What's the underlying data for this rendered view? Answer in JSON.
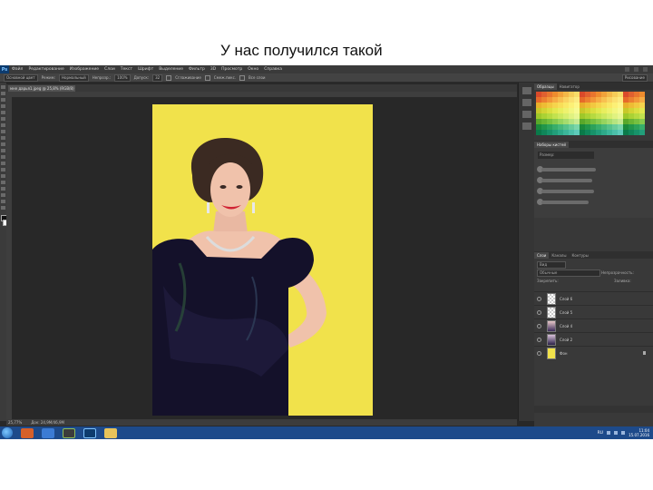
{
  "slide": {
    "caption": "У нас получился такой"
  },
  "app": {
    "logo": "Ps",
    "menu": [
      "Файл",
      "Редактирование",
      "Изображение",
      "Слои",
      "Текст",
      "Шрифт",
      "Выделение",
      "Фильтр",
      "3D",
      "Просмотр",
      "Окно",
      "Справка"
    ],
    "options": {
      "preset": "Основной цвет",
      "mode_label": "Режим:",
      "mode_value": "Нормальный",
      "opacity_label": "Непрозр.:",
      "opacity_value": "100%",
      "tolerance_label": "Допуск:",
      "tolerance_value": "32",
      "antialias_label": "Сглаживание",
      "contiguous_label": "Смеж.пикс.",
      "all_layers_label": "Все слои",
      "workspace": "Рисование"
    },
    "document_tab": "мне дарья1.jpeg @ 25,8% (RGB/8) *",
    "status": {
      "zoom": "25,77%",
      "doc_size": "Док: 24,9М/46,9М"
    },
    "panels": {
      "swatch_tabs": [
        "Образцы",
        "Навигатор"
      ],
      "brush_tab": "Наборы кистей",
      "brush_size_label": "Размер:",
      "layer_tabs": [
        "Слои",
        "Каналы",
        "Контуры"
      ],
      "filter_kind": "Вид",
      "blend_mode": "Обычные",
      "opacity_label": "Непрозрачность:",
      "lock_label": "Закрепить:",
      "fill_label": "Заливка:",
      "layers": [
        {
          "name": "Слой 6"
        },
        {
          "name": "Слой 5"
        },
        {
          "name": "Слой 4"
        },
        {
          "name": "Слой 2"
        },
        {
          "name": "Фон"
        }
      ]
    }
  },
  "taskbar": {
    "lang": "RU",
    "time": "11:04",
    "date": "15.07.2016"
  }
}
